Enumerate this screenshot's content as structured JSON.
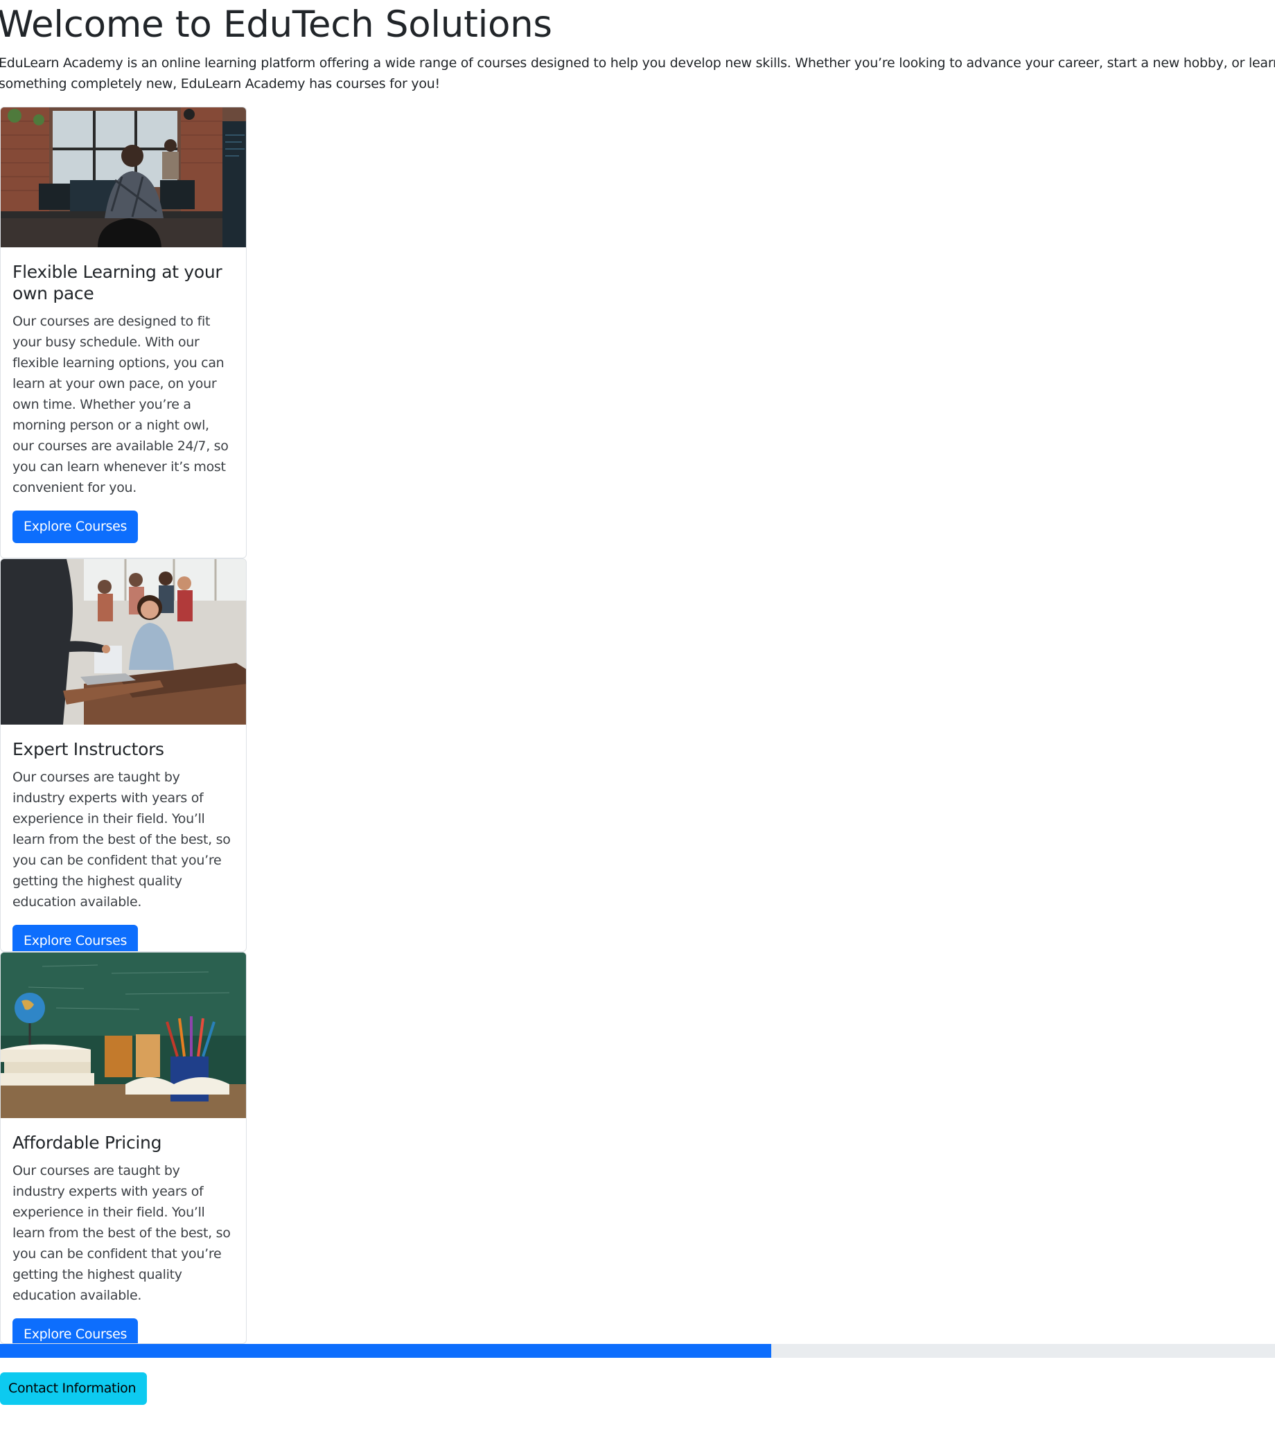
{
  "page": {
    "title": "Welcome to EduTech Solutions",
    "intro": "EduLearn Academy is an online learning platform offering a wide range of courses designed to help you develop new skills. Whether you’re looking to advance your career, start a new hobby, or learn something completely new, EduLearn Academy has courses for you!"
  },
  "cards": [
    {
      "image": "developer-workspace-photo",
      "title": "Flexible Learning at your own pace",
      "text": "Our courses are designed to fit your busy schedule. With our flexible learning options, you can learn at your own pace, on your own time. Whether you’re a morning person or a night owl, our courses are available 24/7, so you can learn whenever it’s most convenient for you.",
      "button_label": "Explore Courses"
    },
    {
      "image": "classroom-instructor-photo",
      "title": "Expert Instructors",
      "text": "Our courses are taught by industry experts with years of experience in their field. You’ll learn from the best of the best, so you can be confident that you’re getting the highest quality education available.",
      "button_label": "Explore Courses"
    },
    {
      "image": "books-and-pencils-photo",
      "title": "Affordable Pricing",
      "text": "Our courses are taught by industry experts with years of experience in their field. You’ll learn from the best of the best, so you can be confident that you’re getting the highest quality education available.",
      "button_label": "Explore Courses"
    }
  ],
  "progress": {
    "value_percent": 60.5
  },
  "contact_button_label": "Contact Information",
  "colors": {
    "primary": "#0d6efd",
    "info": "#0dcaf0",
    "track": "#e9ecef",
    "text": "#212529"
  }
}
